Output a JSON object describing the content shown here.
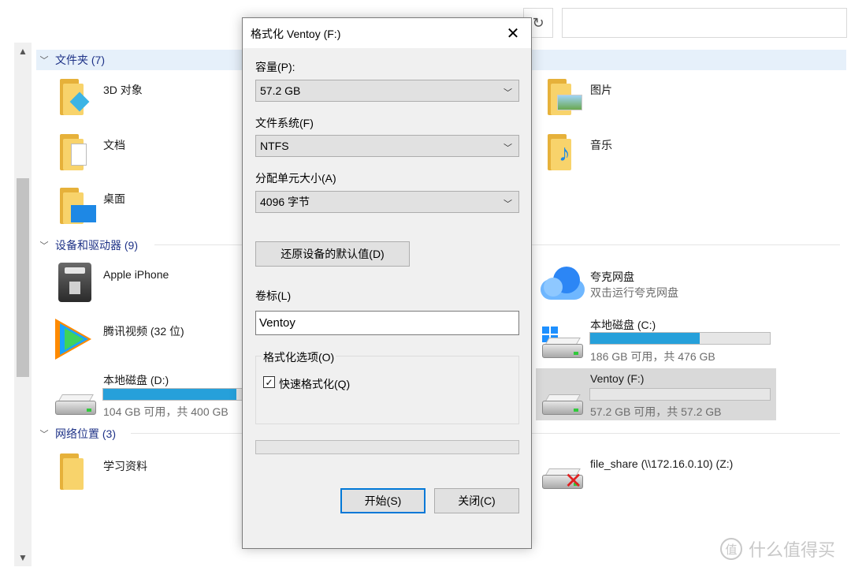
{
  "explorer": {
    "refresh_icon": "↻",
    "groups": {
      "folders": "文件夹 (7)",
      "devices": "设备和驱动器 (9)",
      "network": "网络位置 (3)"
    },
    "folders": [
      {
        "label": "3D 对象",
        "icon": "3d-objects-folder-icon"
      },
      {
        "label": "图片",
        "icon": "pictures-folder-icon"
      },
      {
        "label": "文档",
        "icon": "documents-folder-icon"
      },
      {
        "label": "音乐",
        "icon": "music-folder-icon"
      },
      {
        "label": "桌面",
        "icon": "desktop-folder-icon"
      }
    ],
    "devices": {
      "iphone": "Apple iPhone",
      "quark": "夸克网盘",
      "quark_sub": "双击运行夸克网盘",
      "tencent": "腾讯视频 (32 位)",
      "drive_c": {
        "label": "本地磁盘 (C:)",
        "info": "186 GB 可用，共 476 GB",
        "used_fraction": 0.61
      },
      "drive_d": {
        "label": "本地磁盘 (D:)",
        "info": "104 GB 可用，共 400 GB",
        "used_fraction": 0.74
      },
      "drive_f": {
        "label": "Ventoy (F:)",
        "info": "57.2 GB 可用，共 57.2 GB",
        "used_fraction": 0.0
      }
    },
    "network": {
      "study": "学习资料",
      "share": "file_share (\\\\172.16.0.10) (Z:)"
    }
  },
  "dialog": {
    "title": "格式化 Ventoy (F:)",
    "close_glyph": "✕",
    "capacity_label": "容量(P):",
    "capacity_value": "57.2 GB",
    "fs_label": "文件系统(F)",
    "fs_value": "NTFS",
    "alloc_label": "分配单元大小(A)",
    "alloc_value": "4096 字节",
    "restore_button": "还原设备的默认值(D)",
    "volume_label": "卷标(L)",
    "volume_value": "Ventoy",
    "options_label": "格式化选项(O)",
    "quick_format_label": "快速格式化(Q)",
    "quick_format_checked": true,
    "progress": 0,
    "start_button": "开始(S)",
    "close_button": "关闭(C)"
  },
  "watermark": {
    "logo_glyph": "值",
    "text": "什么值得买"
  }
}
